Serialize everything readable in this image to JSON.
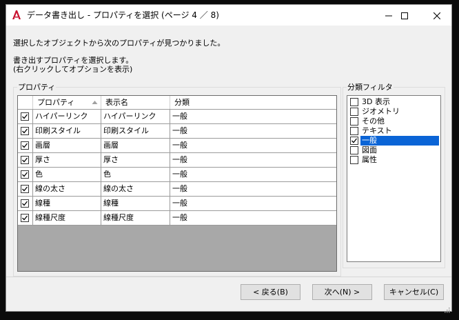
{
  "window": {
    "title": "データ書き出し - プロパティを選択 (ページ 4 ／ 8)",
    "controls": [
      "minimize-icon",
      "maximize-icon",
      "close-icon"
    ]
  },
  "messages": {
    "line1": "選択したオブジェクトから次のプロパティが見つかりました。",
    "line2": "書き出すプロパティを選択します。",
    "line3": "(右クリックしてオプションを表示)"
  },
  "properties_group": {
    "label": "プロパティ",
    "columns": [
      "プロパティ",
      "表示名",
      "分類"
    ],
    "sort_column": "プロパティ",
    "rows": [
      {
        "property": "ハイパーリンク",
        "display_name": "ハイパーリンク",
        "category": "一般",
        "checked": true
      },
      {
        "property": "印刷スタイル",
        "display_name": "印刷スタイル",
        "category": "一般",
        "checked": true
      },
      {
        "property": "画層",
        "display_name": "画層",
        "category": "一般",
        "checked": true
      },
      {
        "property": "厚さ",
        "display_name": "厚さ",
        "category": "一般",
        "checked": true
      },
      {
        "property": "色",
        "display_name": "色",
        "category": "一般",
        "checked": true
      },
      {
        "property": "線の太さ",
        "display_name": "線の太さ",
        "category": "一般",
        "checked": true
      },
      {
        "property": "線種",
        "display_name": "線種",
        "category": "一般",
        "checked": true
      },
      {
        "property": "線種尺度",
        "display_name": "線種尺度",
        "category": "一般",
        "checked": true
      }
    ]
  },
  "filter_group": {
    "label": "分類フィルタ",
    "items": [
      {
        "label": "3D 表示",
        "checked": false,
        "selected": false
      },
      {
        "label": "ジオメトリ",
        "checked": false,
        "selected": false
      },
      {
        "label": "その他",
        "checked": false,
        "selected": false
      },
      {
        "label": "テキスト",
        "checked": false,
        "selected": false
      },
      {
        "label": "一般",
        "checked": true,
        "selected": true
      },
      {
        "label": "図面",
        "checked": false,
        "selected": false
      },
      {
        "label": "属性",
        "checked": false,
        "selected": false
      }
    ]
  },
  "buttons": {
    "back": "< 戻る(B)",
    "next": "次へ(N) >",
    "cancel": "キャンセル(C)"
  },
  "colors": {
    "accent": "#0a64d6",
    "app_icon": "#c8102e",
    "grid_empty": "#a8a8a8"
  }
}
